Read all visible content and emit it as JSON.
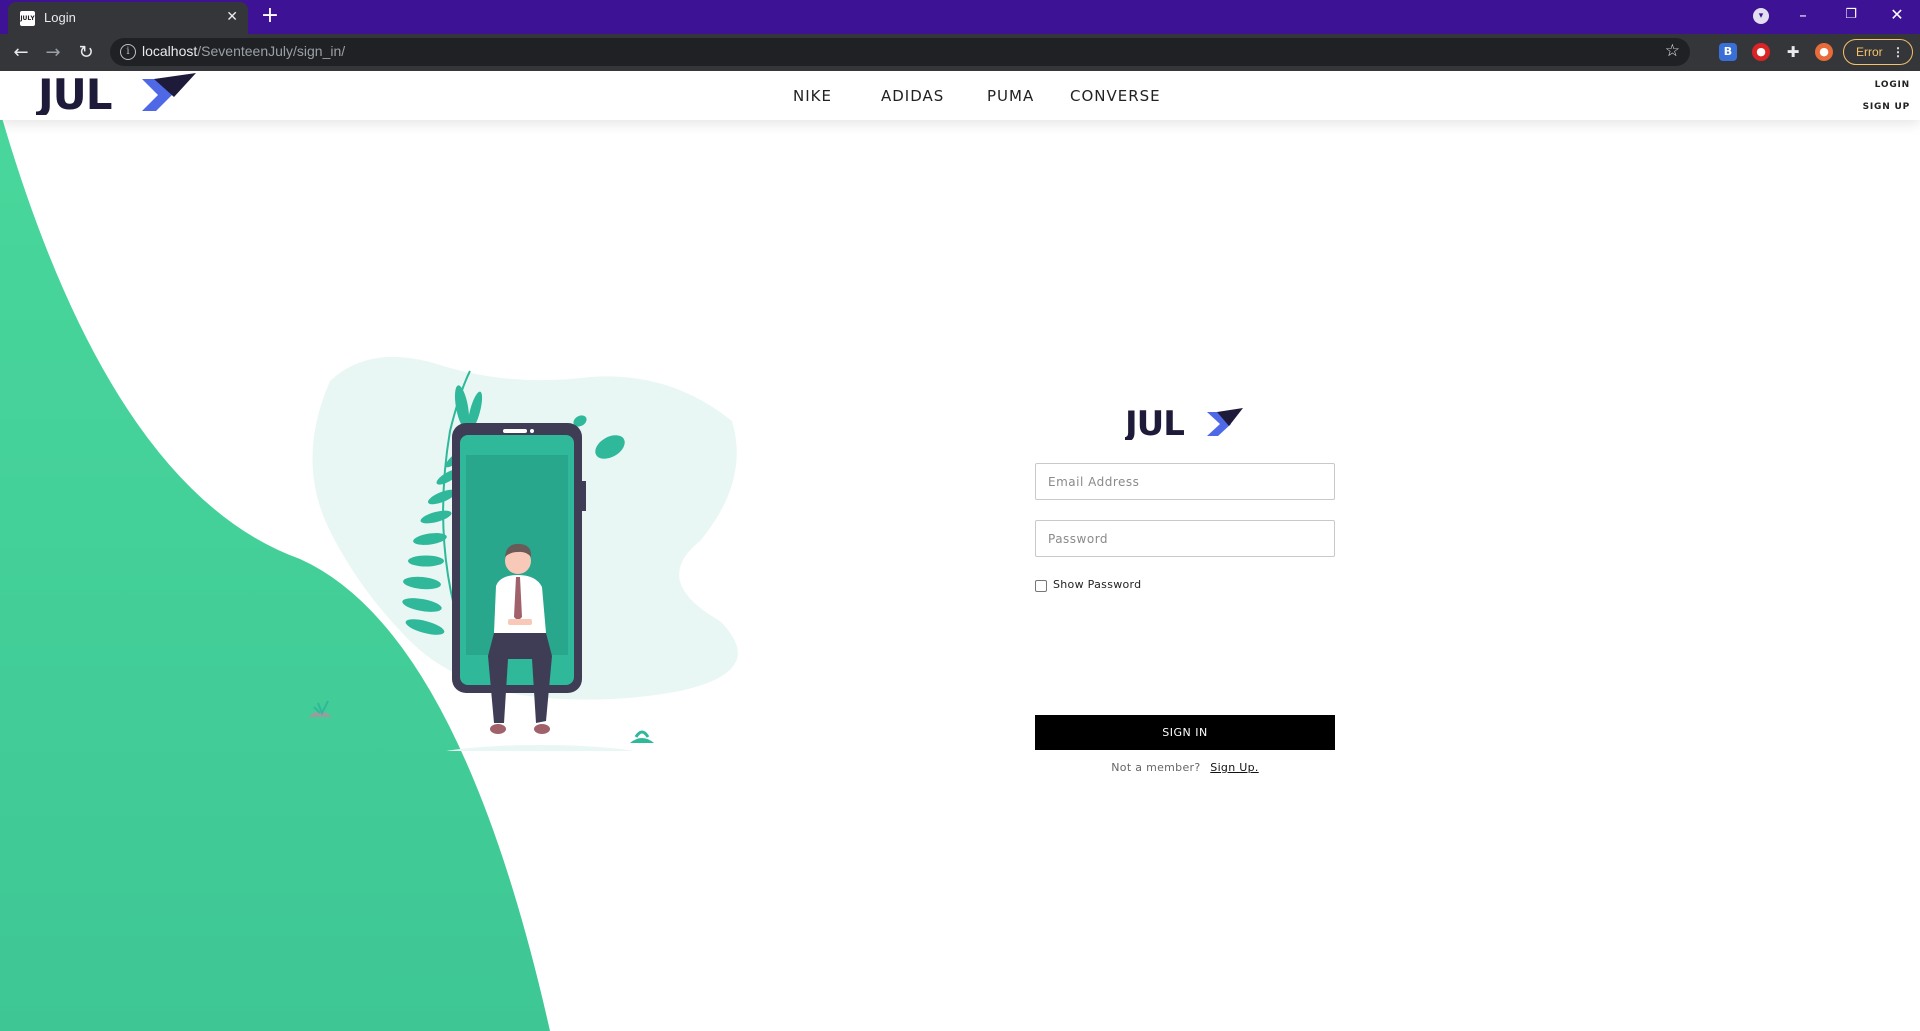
{
  "browser": {
    "tab_title": "Login",
    "tab_favicon_text": "JULY",
    "url_host": "localhost",
    "url_path": "/SeventeenJuly/sign_in/",
    "error_chip": "Error"
  },
  "header": {
    "nav": [
      "NIKE",
      "ADIDAS",
      "PUMA",
      "CONVERSE"
    ],
    "login": "LOGIN",
    "signup": "SIGN UP",
    "logo_text": "JULY"
  },
  "form": {
    "logo_text": "JULY",
    "email_placeholder": "Email Address",
    "password_placeholder": "Password",
    "show_password": "Show Password",
    "submit": "SIGN IN",
    "member_prompt": "Not a member?",
    "signup_link": "Sign Up."
  },
  "colors": {
    "browser_accent": "#3e1295",
    "brand_dark": "#1e1a3a",
    "brand_blue": "#4f68e6",
    "green_wave": "#46d39a",
    "illustration_teal": "#2fb89a",
    "phone_frame": "#3f3d56"
  }
}
